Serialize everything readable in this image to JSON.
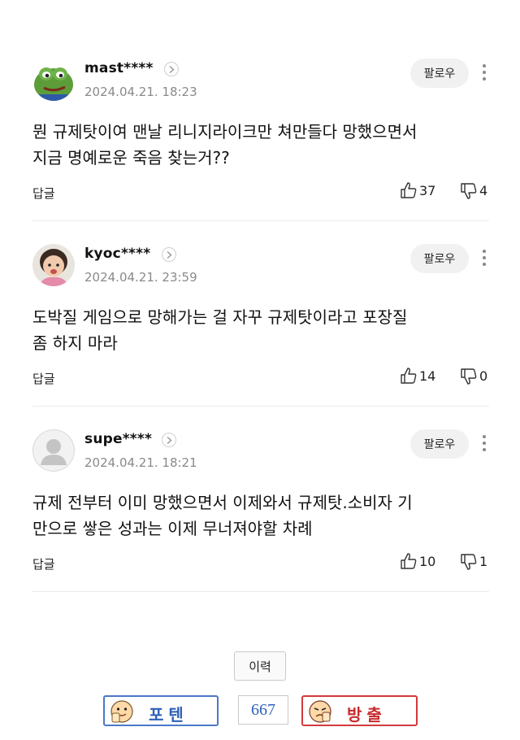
{
  "comments": [
    {
      "nickname": "mast****",
      "date": "2024.04.21. 18:23",
      "follow_label": "팔로우",
      "body": "뭔 규제탓이여 맨날 리니지라이크만 쳐만들다 망했으면서\n지금 명예로운 죽음 찾는거??",
      "reply_label": "답글",
      "likes": "37",
      "dislikes": "4",
      "avatar": "frog-avatar"
    },
    {
      "nickname": "kyoc****",
      "date": "2024.04.21. 23:59",
      "follow_label": "팔로우",
      "body": "도박질 게임으로 망해가는 걸 자꾸 규제탓이라고 포장질\n좀 하지 마라",
      "reply_label": "답글",
      "likes": "14",
      "dislikes": "0",
      "avatar": "child-avatar"
    },
    {
      "nickname": "supe****",
      "date": "2024.04.21. 18:21",
      "follow_label": "팔로우",
      "body": "규제 전부터 이미 망했으면서 이제와서 규제탓.소비자 기\n만으로 쌓은 성과는 이제 무너져야할 차례",
      "reply_label": "답글",
      "likes": "10",
      "dislikes": "1",
      "avatar": "default-avatar"
    }
  ],
  "footer": {
    "history_label": "이력",
    "potion_label": "포텐",
    "count": "667",
    "ban_label": "방출"
  },
  "colors": {
    "potion": "#2e5fb8",
    "ban": "#c72a2a"
  }
}
